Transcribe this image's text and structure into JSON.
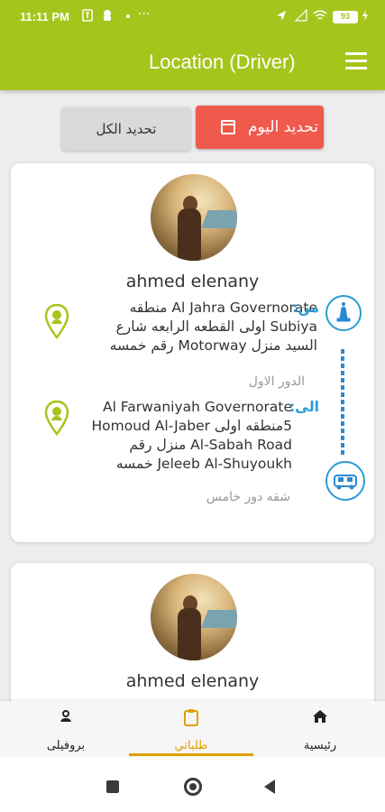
{
  "status_bar": {
    "time": "11:11 PM",
    "battery": "93",
    "icons": [
      "usb-icon",
      "android-icon",
      "more-icon",
      "location-icon",
      "signal-icon",
      "wifi-icon",
      "charging-icon"
    ]
  },
  "app_bar": {
    "title": "Location (Driver)",
    "menu_icon": "hamburger-menu-icon"
  },
  "filters": {
    "today_label": "تحديد اليوم",
    "all_label": "تحديد الكل",
    "active_color": "#f05a4d"
  },
  "orders": [
    {
      "driver_name": "ahmed elenany",
      "from_tag": "من:",
      "from_address": "Al Jahra Governorate منطقه Subiya اولى القطعه الرابعه شارع السيد منزل Motorway رقم خمسه",
      "from_note": "الدور الاول",
      "to_tag": "الى:",
      "to_address": "Al Farwaniyah Governorate 5منطقه اولى Homoud Al-Jaber Al-Sabah Road منزل رقم Jeleeb Al-Shuyoukh خمسه",
      "to_note": "شقه دور خامس"
    },
    {
      "driver_name": "ahmed elenany"
    }
  ],
  "bottom_nav": {
    "home_label": "رئيسية",
    "orders_label": "طلباتي",
    "profile_label": "بروفيلى",
    "active_color": "#e0a000"
  },
  "colors": {
    "primary": "#a6c51c",
    "route_blue": "#2a9ad6"
  }
}
